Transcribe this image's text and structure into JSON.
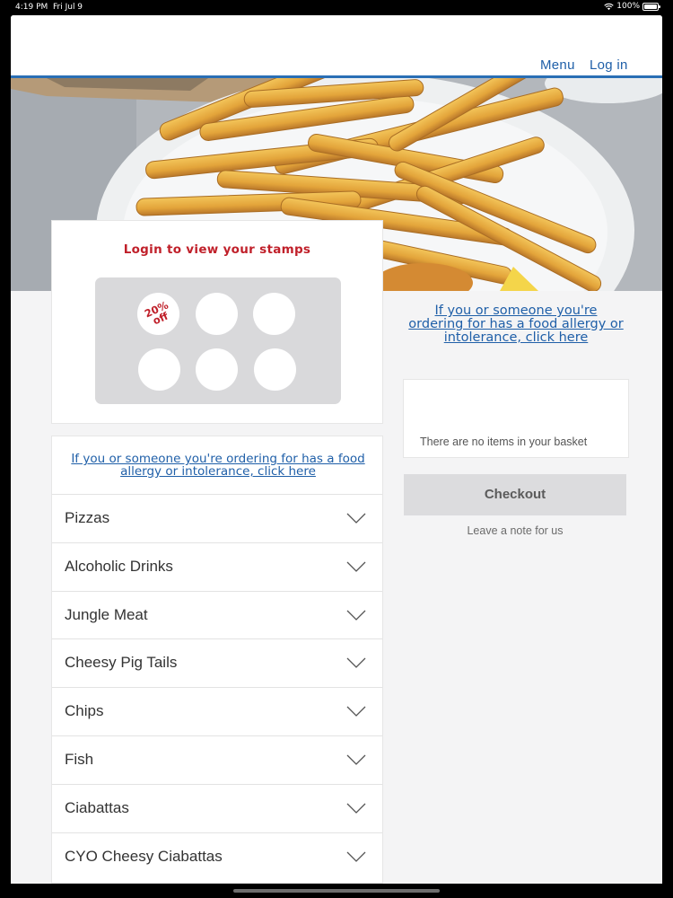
{
  "status_bar": {
    "time": "4:19 PM",
    "date": "Fri Jul 9",
    "battery": "100%"
  },
  "header": {
    "menu_label": "Menu",
    "login_label": "Log in"
  },
  "stamps": {
    "title": "Login to view your stamps",
    "badge_percent": "20%",
    "badge_suffix": "off",
    "total_slots": 6
  },
  "allergy_notice": "If you or someone you're ordering for has a food allergy or intolerance, click here",
  "basket": {
    "empty_text": "There are no items in your basket",
    "checkout_label": "Checkout",
    "note_label": "Leave a note for us"
  },
  "categories": [
    {
      "label": "Pizzas"
    },
    {
      "label": "Alcoholic Drinks"
    },
    {
      "label": "Jungle Meat"
    },
    {
      "label": "Cheesy Pig Tails"
    },
    {
      "label": "Chips"
    },
    {
      "label": "Fish"
    },
    {
      "label": "Ciabattas"
    },
    {
      "label": "CYO Cheesy Ciabattas"
    }
  ],
  "colors": {
    "accent_blue": "#1f5fa8",
    "header_rule": "#2a6fb5",
    "stamp_red": "#c0202a",
    "page_bg": "#f4f4f5"
  }
}
